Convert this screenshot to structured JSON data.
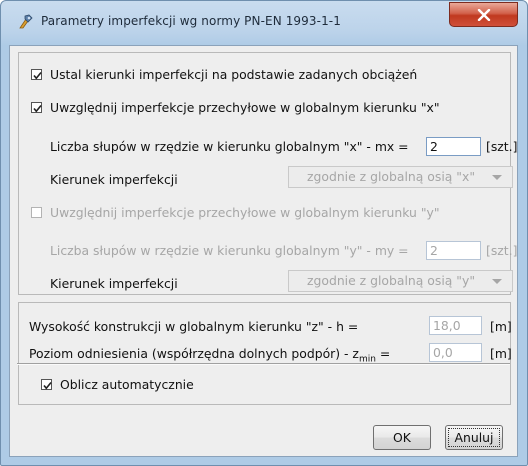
{
  "window": {
    "title": "Parametry imperfekcji wg normy PN-EN 1993-1-1",
    "icon": "app-icon",
    "close_icon": "close-icon"
  },
  "checkboxes": {
    "fixed_directions": {
      "label": "Ustal kierunki imperfekcji na podstawie zadanych obciążeń",
      "checked": true,
      "enabled": true
    },
    "sway_x": {
      "label": "Uwzględnij imperfekcje przechyłowe w globalnym kierunku \"x\"",
      "checked": true,
      "enabled": true
    },
    "sway_y": {
      "label": "Uwzględnij imperfekcje przechyłowe w globalnym kierunku \"y\"",
      "checked": false,
      "enabled": false
    },
    "auto_calc": {
      "label": "Oblicz automatycznie",
      "checked": true,
      "enabled": true
    }
  },
  "x_direction": {
    "columns_label": "Liczba słupów w rzędzie w kierunku globalnym \"x\" - mx =",
    "columns_value": "2",
    "columns_unit": "[szt.]",
    "direction_label": "Kierunek imperfekcji",
    "direction_value": "zgodnie z globalną osią \"x\""
  },
  "y_direction": {
    "columns_label": "Liczba słupów w rzędzie w kierunku globalnym \"y\" - my =",
    "columns_value": "2",
    "columns_unit": "[szt.]",
    "direction_label": "Kierunek imperfekcji",
    "direction_value": "zgodnie z globalną osią \"y\""
  },
  "height": {
    "label": "Wysokość konstrukcji w globalnym kierunku \"z\" - h =",
    "value": "18,0",
    "unit": "[m]"
  },
  "reference": {
    "label_main": "Poziom odniesienia (współrzędna dolnych podpór) - z",
    "label_sub": "min",
    "label_eq": "=",
    "value": "0,0",
    "unit": "[m]"
  },
  "buttons": {
    "ok": "OK",
    "cancel": "Anuluj"
  }
}
